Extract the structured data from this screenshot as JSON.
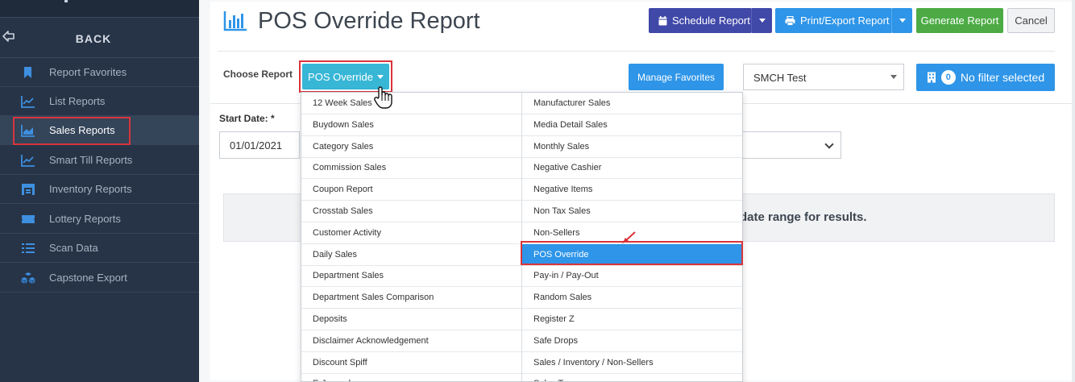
{
  "sidebar": {
    "back_label": "BACK",
    "items": [
      {
        "label": "Report Favorites",
        "icon": "bookmark-icon"
      },
      {
        "label": "List Reports",
        "icon": "line-chart-icon"
      },
      {
        "label": "Sales Reports",
        "icon": "area-chart-icon",
        "active": true
      },
      {
        "label": "Smart Till Reports",
        "icon": "line-chart-icon"
      },
      {
        "label": "Inventory Reports",
        "icon": "warehouse-icon"
      },
      {
        "label": "Lottery Reports",
        "icon": "ticket-icon"
      },
      {
        "label": "Scan Data",
        "icon": "list-icon"
      },
      {
        "label": "Capstone Export",
        "icon": "cubes-icon"
      }
    ]
  },
  "header": {
    "title": "POS Override Report",
    "schedule_label": "Schedule Report",
    "print_label": "Print/Export Report",
    "generate_label": "Generate Report",
    "cancel_label": "Cancel"
  },
  "filters": {
    "choose_label": "Choose Report",
    "report_value": "POS Override",
    "manage_label": "Manage Favorites",
    "store_value": "SMCH Test",
    "filter_count": "0",
    "filter_label": "No filter selected",
    "start_label": "Start Date: *",
    "start_value": "01/01/2021"
  },
  "message": "date range for results.",
  "dropdown": {
    "left": [
      "12 Week Sales",
      "Buydown Sales",
      "Category Sales",
      "Commission Sales",
      "Coupon Report",
      "Crosstab Sales",
      "Customer Activity",
      "Daily Sales",
      "Department Sales",
      "Department Sales Comparison",
      "Deposits",
      "Disclaimer Acknowledgement",
      "Discount Spiff",
      "E-Journal"
    ],
    "right": [
      "Manufacturer Sales",
      "Media Detail Sales",
      "Monthly Sales",
      "Negative Cashier",
      "Negative Items",
      "Non Tax Sales",
      "Non-Sellers",
      "POS Override",
      "Pay-in / Pay-Out",
      "Random Sales",
      "Register Z",
      "Safe Drops",
      "Sales / Inventory / Non-Sellers",
      "Sales Tax"
    ],
    "selected": "POS Override"
  },
  "colors": {
    "sidebar_bg": "#273447",
    "primary": "#2e95e8",
    "indigo": "#4048a8",
    "success": "#4cab45",
    "highlight": "#d9343b"
  }
}
